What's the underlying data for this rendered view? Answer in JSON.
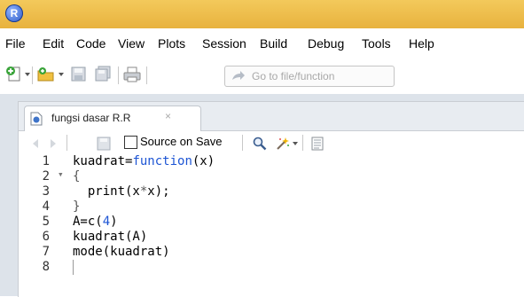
{
  "app": {
    "logo_letter": "R"
  },
  "menu": [
    "File",
    "Edit",
    "Code",
    "View",
    "Plots",
    "Session",
    "Build",
    "Debug",
    "Tools",
    "Help"
  ],
  "toolbar": {
    "goto_placeholder": "Go to file/function"
  },
  "editor": {
    "tab_label": "fungsi dasar R.R",
    "tab_close": "×",
    "source_on_save_label": "Source on Save",
    "source_on_save_checked": false
  },
  "code_lines": [
    {
      "number": "1",
      "fold": "",
      "tokens": [
        [
          "kuadrat=",
          ""
        ],
        [
          "function",
          "kw"
        ],
        [
          "(x)",
          ""
        ]
      ]
    },
    {
      "number": "2",
      "fold": "▾",
      "tokens": [
        [
          "{",
          "op"
        ]
      ]
    },
    {
      "number": "3",
      "fold": "",
      "tokens": [
        [
          "  print(x",
          ""
        ],
        [
          "*",
          "op"
        ],
        [
          "x);",
          ""
        ]
      ]
    },
    {
      "number": "4",
      "fold": "",
      "tokens": [
        [
          "}",
          "op"
        ]
      ]
    },
    {
      "number": "5",
      "fold": "",
      "tokens": [
        [
          "A=c(",
          ""
        ],
        [
          "4",
          "num"
        ],
        [
          ")",
          ""
        ]
      ]
    },
    {
      "number": "6",
      "fold": "",
      "tokens": [
        [
          "kuadrat(A)",
          ""
        ]
      ]
    },
    {
      "number": "7",
      "fold": "",
      "tokens": [
        [
          "mode(kuadrat)",
          ""
        ]
      ]
    },
    {
      "number": "8",
      "fold": "",
      "tokens": []
    }
  ],
  "colors": {
    "titlebar": "#e8b23e",
    "keyword": "#1d55d4",
    "pane_background": "#dde3ea"
  }
}
